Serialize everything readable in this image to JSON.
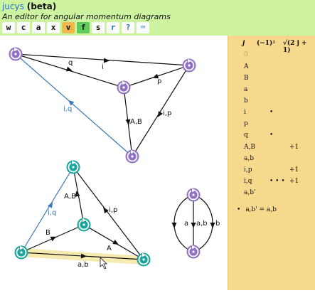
{
  "app": {
    "name": "jucys",
    "beta": "(beta)",
    "subtitle": "An editor for angular momentum diagrams"
  },
  "toolbar": [
    {
      "key": "w",
      "label": "w",
      "bg": "#fbfbfb",
      "fg": "#111"
    },
    {
      "key": "c",
      "label": "c",
      "bg": "#fbfbfb",
      "fg": "#111"
    },
    {
      "key": "a",
      "label": "a",
      "bg": "#fbfbfb",
      "fg": "#111"
    },
    {
      "key": "x",
      "label": "x",
      "bg": "#fbfbfb",
      "fg": "#111"
    },
    {
      "key": "v",
      "label": "v",
      "bg": "#f2b84b",
      "fg": "#111"
    },
    {
      "key": "f",
      "label": "f",
      "bg": "#5ecb5e",
      "fg": "#111"
    },
    {
      "key": "s",
      "label": "s",
      "bg": "#fbfbfb",
      "fg": "#111"
    },
    {
      "key": "r",
      "label": "r",
      "bg": "#fbfbfb",
      "fg": "#2a6fc4"
    },
    {
      "key": "?",
      "label": "?",
      "bg": "#fbfbfb",
      "fg": "#2a6fc4"
    },
    {
      "key": "kbd",
      "label": "⌨",
      "bg": "#fbfbfb",
      "fg": "#2a6fc4"
    }
  ],
  "panel": {
    "headers": {
      "j": "j",
      "phase": "(−1)ʲ",
      "dim": "√(2 j + 1)"
    },
    "rows": [
      {
        "label": "0",
        "dots": "",
        "val": "",
        "muted": true
      },
      {
        "label": "A",
        "dots": "",
        "val": ""
      },
      {
        "label": "B",
        "dots": "",
        "val": ""
      },
      {
        "label": "a",
        "dots": "",
        "val": ""
      },
      {
        "label": "b",
        "dots": "",
        "val": ""
      },
      {
        "label": "i",
        "dots": "•",
        "val": ""
      },
      {
        "label": "p",
        "dots": "",
        "val": ""
      },
      {
        "label": "q",
        "dots": "•",
        "val": ""
      },
      {
        "label": "A,B",
        "dots": "",
        "val": "+1"
      },
      {
        "label": "a,b",
        "dots": "",
        "val": ""
      },
      {
        "label": "i,p",
        "dots": "",
        "val": "+1"
      },
      {
        "label": "i,q",
        "dots": "• • •",
        "val": "+1"
      },
      {
        "label": "a,b'",
        "dots": "",
        "val": ""
      }
    ],
    "relation": {
      "bullet": "•",
      "text": "a,b' = a,b"
    }
  },
  "diagram": {
    "colors": {
      "nodePurple": "#9071c6",
      "nodeTeal": "#1ba59e",
      "edge": "#111111",
      "edgeBlue": "#3a78b4",
      "highlight": "#f5eab0"
    },
    "edgeLabels": {
      "q": "q",
      "i": "i",
      "p": "p",
      "iq1": "i,q",
      "AB1": "A,B",
      "ip1": "i,p",
      "AB2": "A,B",
      "iq2": "i,q",
      "ip2": "i,p",
      "B": "B",
      "A": "A",
      "ab": "a,b",
      "a": "a",
      "ab3": "a,b",
      "b": "b"
    }
  }
}
